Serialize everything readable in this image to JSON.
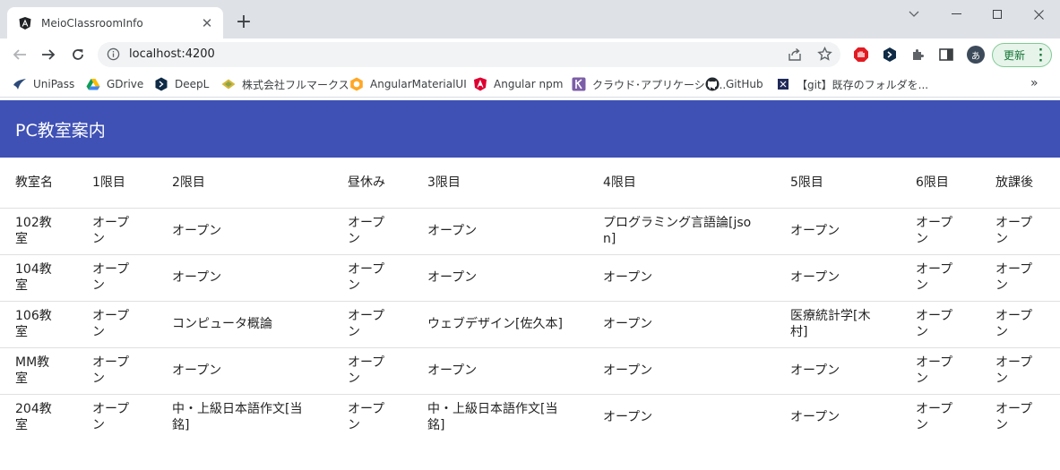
{
  "browser": {
    "tab_title": "MeioClassroomInfo",
    "url": "localhost:4200",
    "update_label": "更新",
    "profile_initial": "あ",
    "bookmarks": [
      {
        "label": "UniPass",
        "icon": "unipass-icon"
      },
      {
        "label": "GDrive",
        "icon": "google-drive-icon"
      },
      {
        "label": "DeepL",
        "icon": "deepl-icon"
      },
      {
        "label": "株式会社フルマークス",
        "icon": "fullmarks-icon"
      },
      {
        "label": "AngularMaterialUI",
        "icon": "angular-material-icon"
      },
      {
        "label": "Angular npm",
        "icon": "angular-icon"
      },
      {
        "label": "クラウド･アプリケーショ...",
        "icon": "cloud-app-icon"
      },
      {
        "label": "GitHub",
        "icon": "github-icon"
      },
      {
        "label": "【git】既存のフォルダを...",
        "icon": "git-article-icon"
      }
    ]
  },
  "app": {
    "title": "PC教室案内",
    "colors": {
      "primary": "#3f51b5"
    },
    "table": {
      "headers": [
        "教室名",
        "1限目",
        "2限目",
        "昼休み",
        "3限目",
        "4限目",
        "5限目",
        "6限目",
        "放課後"
      ],
      "rows": [
        [
          "102教室",
          "オープン",
          "オープン",
          "オープン",
          "オープン",
          "プログラミング言語論[json]",
          "オープン",
          "オープン",
          "オープン"
        ],
        [
          "104教室",
          "オープン",
          "オープン",
          "オープン",
          "オープン",
          "オープン",
          "オープン",
          "オープン",
          "オープン"
        ],
        [
          "106教室",
          "オープン",
          "コンピュータ概論",
          "オープン",
          "ウェブデザイン[佐久本]",
          "オープン",
          "医療統計学[木村]",
          "オープン",
          "オープン"
        ],
        [
          "MM教室",
          "オープン",
          "オープン",
          "オープン",
          "オープン",
          "オープン",
          "オープン",
          "オープン",
          "オープン"
        ],
        [
          "204教室",
          "オープン",
          "中・上級日本語作文[当銘]",
          "オープン",
          "中・上級日本語作文[当銘]",
          "オープン",
          "オープン",
          "オープン",
          "オープン"
        ]
      ]
    }
  }
}
